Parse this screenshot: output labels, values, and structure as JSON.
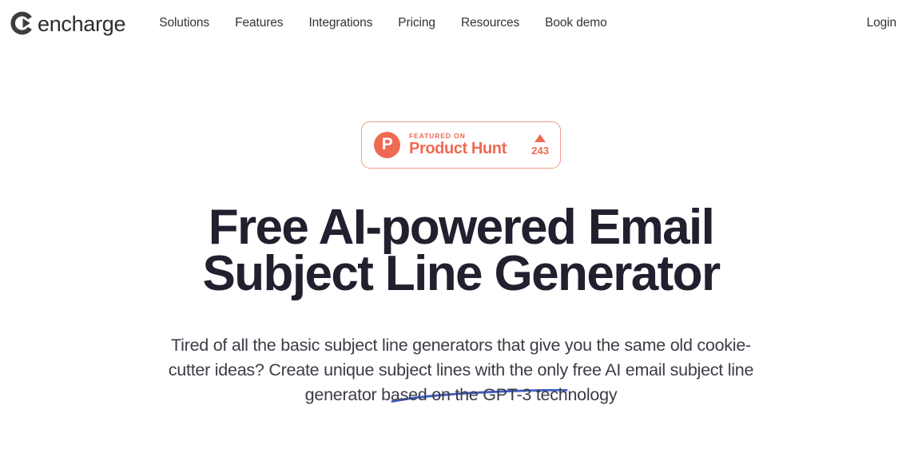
{
  "header": {
    "brand": {
      "word": "encharge",
      "mark_icon": "encharge-circle-arrow-logo"
    },
    "nav": [
      {
        "label": "Solutions"
      },
      {
        "label": "Features"
      },
      {
        "label": "Integrations"
      },
      {
        "label": "Pricing"
      },
      {
        "label": "Resources"
      },
      {
        "label": "Book demo"
      }
    ],
    "login_label": "Login"
  },
  "hero": {
    "badge": {
      "logo_letter": "P",
      "logo_icon": "product-hunt-logo",
      "featured_label": "FEATURED ON",
      "name": "Product Hunt",
      "upvote_icon": "upvote-triangle-icon",
      "upvote_count": "243",
      "accent_color": "#ef6a53",
      "border_color": "#ef9a85"
    },
    "title_line_1": "Free AI-powered Email",
    "title_line_2": "Subject Line Generator",
    "title_color": "#20202e",
    "subheading": "Tired of all the basic subject line generators that give you the same old cookie-cutter ideas? Create unique subject lines with the only free AI email subject line generator based on the GPT-3 technology",
    "underline_icon": "hand-drawn-underline-swoosh",
    "underline_color": "#3f5ec4"
  }
}
